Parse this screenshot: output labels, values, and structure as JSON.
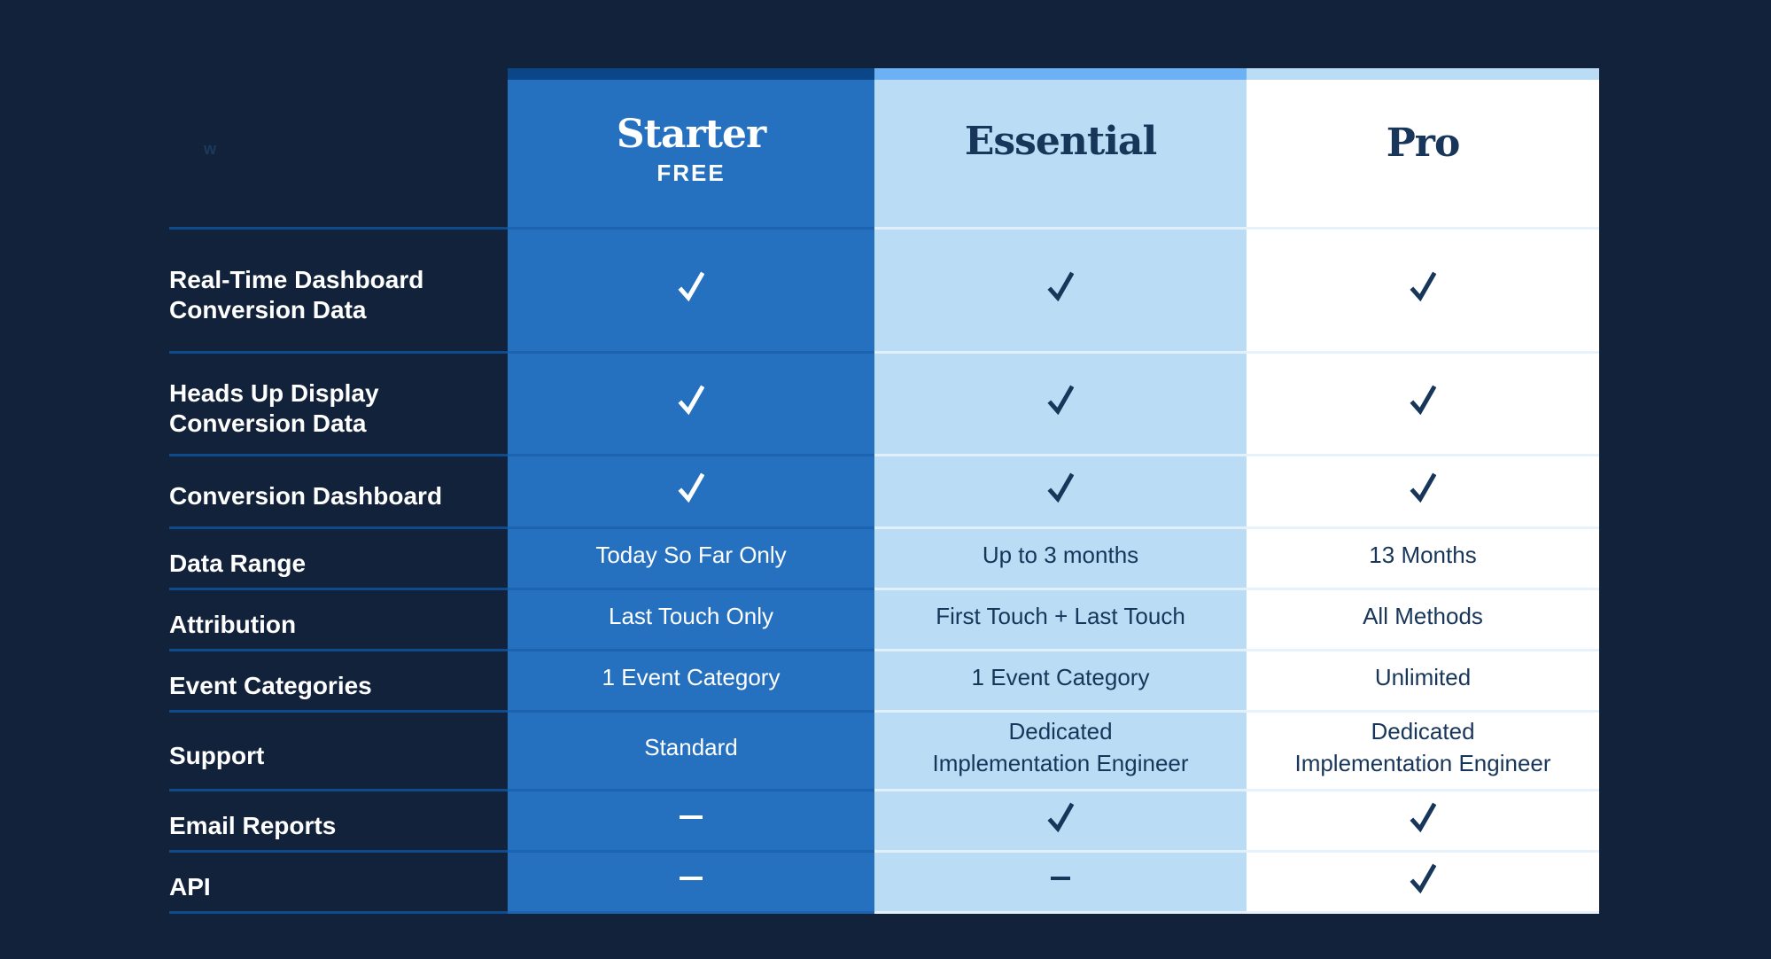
{
  "watermark": "w",
  "plans": [
    {
      "name": "Starter",
      "subtitle": "FREE"
    },
    {
      "name": "Essential",
      "subtitle": ""
    },
    {
      "name": "Pro",
      "subtitle": ""
    }
  ],
  "colors": {
    "background": "#12223b",
    "starter": "#2670c0",
    "starter_band": "#0b4688",
    "essential": "#badcf5",
    "essential_band": "#6bb1f4",
    "pro": "#ffffff",
    "pro_band": "#badcf5",
    "text_dark": "#17365a"
  },
  "features": [
    {
      "label": "Real-Time Dashboard\nConversion Data",
      "values": [
        "check",
        "check",
        "check"
      ]
    },
    {
      "label": "Heads Up Display\nConversion Data",
      "values": [
        "check",
        "check",
        "check"
      ]
    },
    {
      "label": "Conversion Dashboard",
      "values": [
        "check",
        "check",
        "check"
      ]
    },
    {
      "label": "Data Range",
      "values": [
        "Today So Far Only",
        "Up to 3 months",
        "13 Months"
      ]
    },
    {
      "label": "Attribution",
      "values": [
        "Last Touch Only",
        "First Touch + Last Touch",
        "All Methods"
      ]
    },
    {
      "label": "Event Categories",
      "values": [
        "1 Event Category",
        "1 Event Category",
        "Unlimited"
      ]
    },
    {
      "label": "Support",
      "values": [
        "Standard",
        "Dedicated\nImplementation Engineer",
        "Dedicated\nImplementation Engineer"
      ]
    },
    {
      "label": "Email Reports",
      "values": [
        "dash",
        "check",
        "check"
      ]
    },
    {
      "label": "API",
      "values": [
        "dash",
        "dash",
        "check"
      ]
    }
  ]
}
